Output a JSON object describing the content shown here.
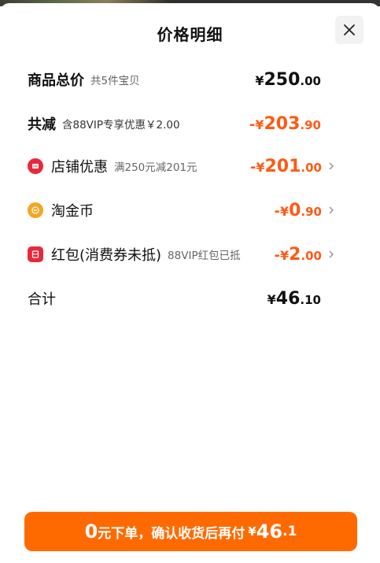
{
  "sheet": {
    "title": "价格明细",
    "close_icon": "close-icon"
  },
  "rows": {
    "total": {
      "label": "商品总价",
      "sub": "共5件宝贝",
      "yen": "¥",
      "int": "250",
      "dec": ".00"
    },
    "discount_total": {
      "label": "共减",
      "sub": "含88VIP专享优惠￥2.00",
      "sign": "-",
      "yen": "¥",
      "int": "203",
      "dec": ".90"
    },
    "store_discount": {
      "label": "店铺优惠",
      "sub": "满250元减201元",
      "icon": "store-coupon-icon",
      "sign": "-",
      "yen": "¥",
      "int": "201",
      "dec": ".00"
    },
    "taojinbi": {
      "label": "淘金币",
      "icon": "coin-icon",
      "sign": "-",
      "yen": "¥",
      "int": "0",
      "dec": ".90"
    },
    "red_packet": {
      "label": "红包(消费券未抵)",
      "sub": "88VIP红包已抵",
      "icon": "red-packet-icon",
      "sign": "-",
      "yen": "¥",
      "int": "2",
      "dec": ".00"
    },
    "subtotal": {
      "label": "合计",
      "yen": "¥",
      "int": "46",
      "dec": ".10"
    }
  },
  "cta": {
    "zero": "0",
    "text": "元下单，确认收货后再付",
    "yen": "¥",
    "int": "46",
    "dec": ".1"
  },
  "colors": {
    "accent": "#ff5a12",
    "button": "#ff6a00",
    "red_icon": "#e8293b",
    "coin_icon": "#f5a623"
  }
}
